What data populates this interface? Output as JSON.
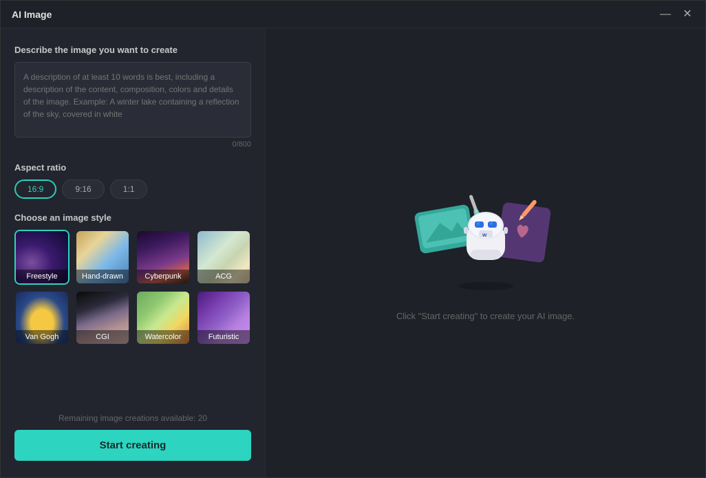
{
  "window": {
    "title": "AI Image",
    "min_btn": "—",
    "close_btn": "✕"
  },
  "left": {
    "describe_label": "Describe the image you want to create",
    "textarea_placeholder": "A description of at least 10 words is best, including a description of the content, composition, colors and details of the image. Example: A winter lake containing a reflection of the sky, covered in white",
    "char_count": "0/800",
    "aspect_ratio_label": "Aspect ratio",
    "aspect_options": [
      {
        "value": "16:9",
        "active": true
      },
      {
        "value": "9:16",
        "active": false
      },
      {
        "value": "1:1",
        "active": false
      }
    ],
    "style_label": "Choose an image style",
    "styles": [
      {
        "name": "freestyle",
        "label": "Freestyle",
        "active": true
      },
      {
        "name": "hand-drawn",
        "label": "Hand-drawn",
        "active": false
      },
      {
        "name": "cyberpunk",
        "label": "Cyberpunk",
        "active": false
      },
      {
        "name": "acg",
        "label": "ACG",
        "active": false
      },
      {
        "name": "van-gogh",
        "label": "Van Gogh",
        "active": false
      },
      {
        "name": "cgi",
        "label": "CGI",
        "active": false
      },
      {
        "name": "watercolor",
        "label": "Watercolor",
        "active": false
      },
      {
        "name": "futuristic",
        "label": "Futuristic",
        "active": false
      }
    ],
    "remaining_text": "Remaining image creations available: 20",
    "start_btn": "Start creating"
  },
  "right": {
    "placeholder_text": "Click \"Start creating\" to create your AI image."
  }
}
